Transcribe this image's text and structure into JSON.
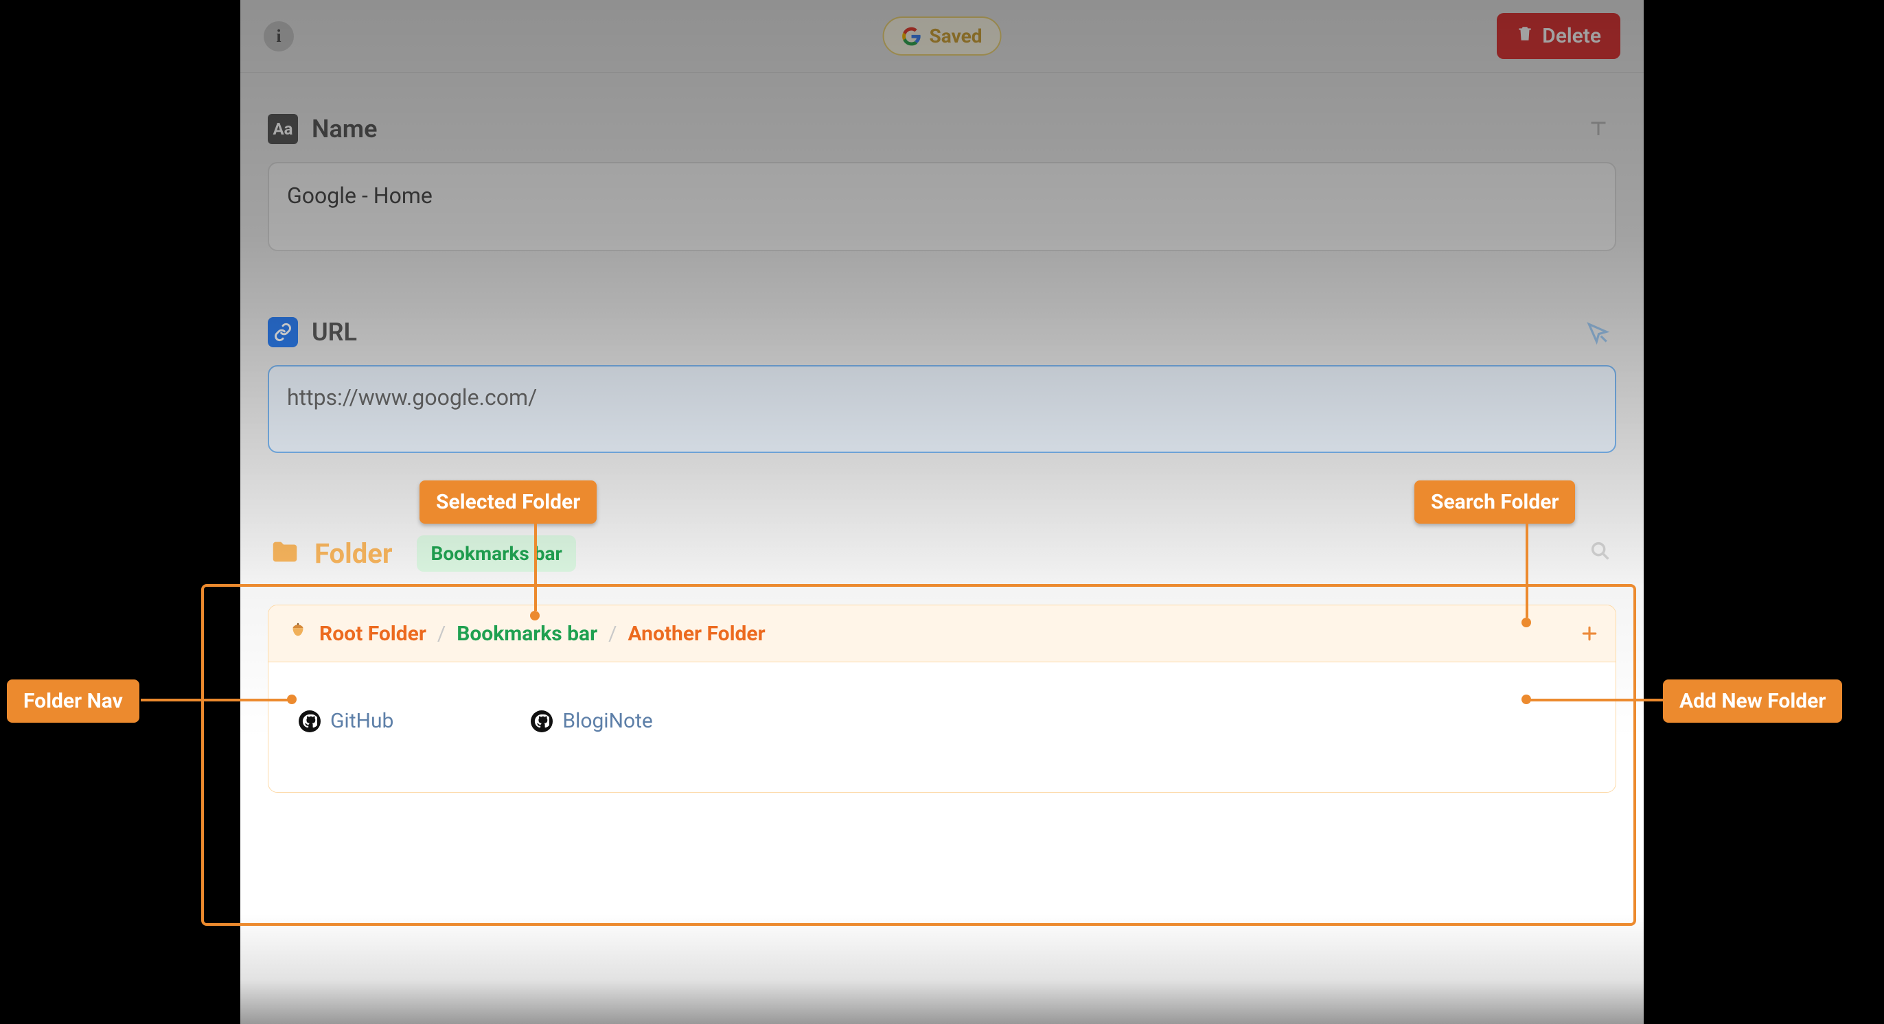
{
  "topbar": {
    "saved_label": "Saved",
    "delete_label": "Delete"
  },
  "name": {
    "label": "Name",
    "value": "Google - Home",
    "icon_text": "Aa"
  },
  "url": {
    "label": "URL",
    "value": "https://www.google.com/"
  },
  "folder": {
    "label": "Folder",
    "selected": "Bookmarks bar",
    "breadcrumb": {
      "root": "Root Folder",
      "current": "Bookmarks bar",
      "next": "Another Folder"
    },
    "items": [
      {
        "label": "GitHub"
      },
      {
        "label": "BlogiNote"
      }
    ]
  },
  "annotations": {
    "selected_folder": "Selected Folder",
    "search_folder": "Search Folder",
    "folder_nav": "Folder Nav",
    "add_new_folder": "Add New Folder"
  }
}
